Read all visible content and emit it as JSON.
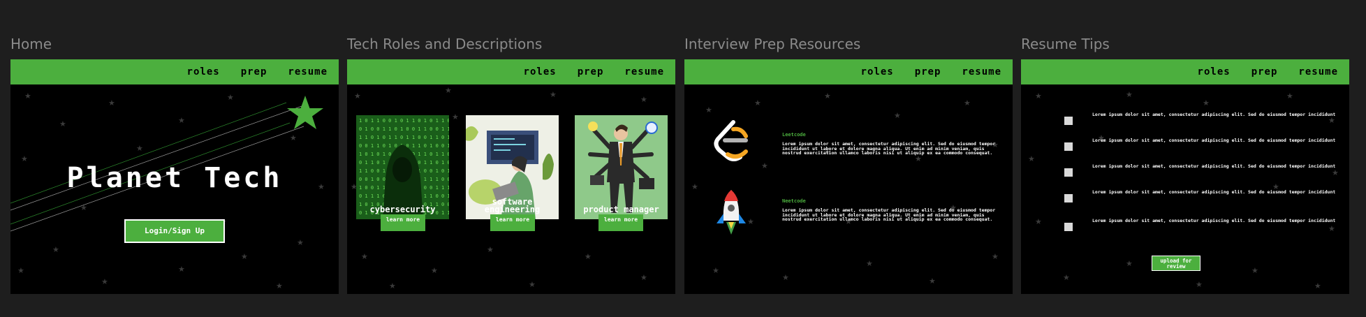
{
  "frames": {
    "home": "Home",
    "roles": "Tech Roles and Descriptions",
    "prep": "Interview Prep Resources",
    "resume": "Resume Tips"
  },
  "nav": {
    "roles": "roles",
    "prep": "prep",
    "resume": "resume"
  },
  "home": {
    "title": "Planet Tech",
    "cta": "Login/Sign Up"
  },
  "roles": {
    "cards": [
      {
        "label": "cybersecurity",
        "button": "learn more"
      },
      {
        "label": "software engineering",
        "button": "learn more"
      },
      {
        "label": "product manager",
        "button": "learn more"
      }
    ]
  },
  "prep": {
    "resources": [
      {
        "name": "Leetcode",
        "description": "Lorem ipsum dolor sit amet, consectetur adipiscing elit. Sed do eiusmod tempor incididunt ut labore et dolore magna aliqua. Ut enim ad minim veniam, quis nostrud exercitation ullamco laboris nisi ut aliquip ex ea commodo consequat."
      },
      {
        "name": "Neetcode",
        "description": "Lorem ipsum dolor sit amet, consectetur adipiscing elit. Sed do eiusmod tempor incididunt ut labore et dolore magna aliqua. Ut enim ad minim veniam, quis nostrud exercitation ullamco laboris nisi ut aliquip ex ea commodo consequat."
      }
    ]
  },
  "resume": {
    "tips": [
      "Lorem ipsum dolor sit amet, consectetur adipiscing elit. Sed do eiusmod tempor incididunt",
      "Lorem ipsum dolor sit amet, consectetur adipiscing elit. Sed do eiusmod tempor incididunt",
      "Lorem ipsum dolor sit amet, consectetur adipiscing elit. Sed do eiusmod tempor incididunt",
      "Lorem ipsum dolor sit amet, consectetur adipiscing elit. Sed do eiusmod tempor incididunt",
      "Lorem ipsum dolor sit amet, consectetur adipiscing elit. Sed do eiusmod tempor incididunt"
    ],
    "upload": "upload for review"
  },
  "colors": {
    "accent": "#4caf3e",
    "background": "#000000",
    "canvas": "#1e1e1e",
    "star": "#3a3a3a"
  }
}
